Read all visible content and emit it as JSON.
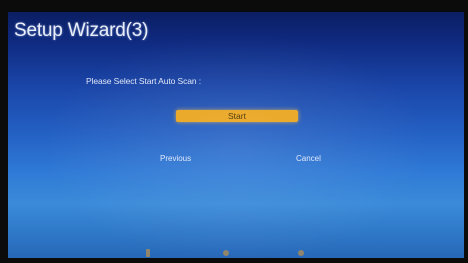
{
  "wizard": {
    "title": "Setup Wizard(3)",
    "prompt": "Please Select Start Auto Scan :",
    "start_label": "Start",
    "previous_label": "Previous",
    "cancel_label": "Cancel"
  },
  "hint_icons": [
    "move-key-icon",
    "adjust-key-icon",
    "select-key-icon"
  ],
  "colors": {
    "highlight": "#e9a51e",
    "background_top": "#0b1e63",
    "background_bottom": "#2f78c8",
    "text": "#dfe6f7"
  }
}
